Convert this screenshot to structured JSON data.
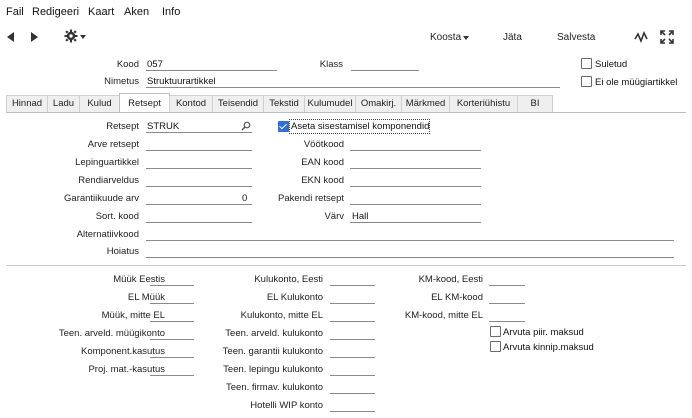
{
  "menu": {
    "items": [
      "Fail",
      "Redigeeri",
      "Kaart",
      "Aken",
      "Info"
    ]
  },
  "toolbar": {
    "koosta_label": "Koosta",
    "jata_label": "Jäta",
    "salvesta_label": "Salvesta"
  },
  "header": {
    "kood_label": "Kood",
    "kood_value": "057",
    "klass_label": "Klass",
    "klass_value": "",
    "nimetus_label": "Nimetus",
    "nimetus_value": "Struktuurartikkel",
    "suletud_label": "Suletud",
    "ei_ole_label": "Ei ole müügiartikkel"
  },
  "tabs": [
    "Hinnad",
    "Ladu",
    "Kulud",
    "Retsept",
    "Kontod",
    "Teisendid",
    "Tekstid",
    "Kulumudel",
    "Omakirj.",
    "Märkmed",
    "Korteriühistu",
    "BI"
  ],
  "active_tab": "Retsept",
  "retsept_tab": {
    "retsept_label": "Retsept",
    "retsept_value": "STRUK",
    "aseta_label": "Aseta sisestamisel komponendid",
    "aseta_checked": true,
    "arve_retsept_label": "Arve retsept",
    "lepinguartikkel_label": "Lepinguartikkel",
    "rendiarveldus_label": "Rendiarveldus",
    "garantii_label": "Garantiikuude arv",
    "garantii_value": "0",
    "sort_kood_label": "Sort. kood",
    "alternatiivkood_label": "Alternatiivkood",
    "hoiatus_label": "Hoiatus",
    "vootkood_label": "Vöötkood",
    "ean_label": "EAN kood",
    "ekn_label": "EKN kood",
    "pakendi_label": "Pakendi retsept",
    "varv_label": "Värv",
    "varv_value": "Hall"
  },
  "accounts": {
    "col1": [
      "Müük Eestis",
      "EL Müük",
      "Müük, mitte EL",
      "Teen. arveld. müügikonto",
      "Komponent.kasutus",
      "Proj. mat.-kasutus"
    ],
    "col2": [
      "Kulukonto, Eesti",
      "EL Kulukonto",
      "Kulukonto, mitte EL",
      "Teen. arveld. kulukonto",
      "Teen. garantii kulukonto",
      "Teen. lepingu kulukonto",
      "Teen. firmav. kulukonto",
      "Hotelli WIP konto"
    ],
    "col3": [
      "KM-kood, Eesti",
      "EL  KM-kood",
      "KM-kood, mitte EL"
    ],
    "arvuta_piir_label": "Arvuta piir. maksud",
    "arvuta_kinnip_label": "Arvuta kinnip.maksud"
  }
}
